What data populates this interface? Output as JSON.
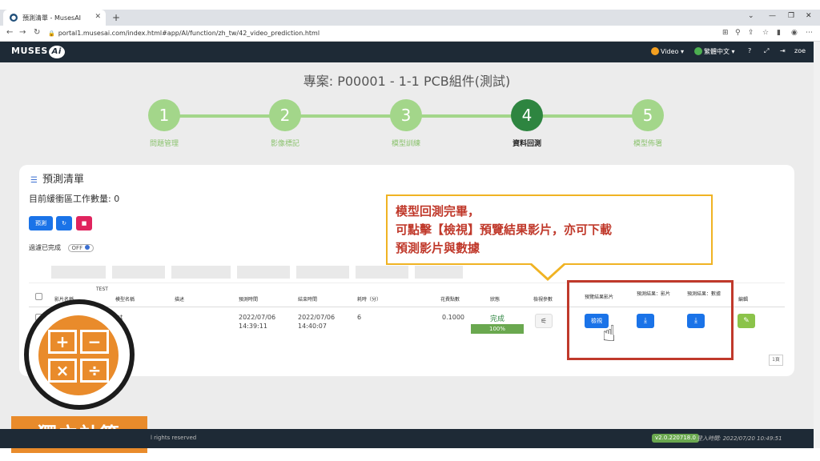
{
  "browser": {
    "tab_title": "預測清單 - MusesAI",
    "new_tab": "+",
    "url": "portal1.musesai.com/index.html#app/AI/function/zh_tw/42_video_prediction.html"
  },
  "header": {
    "logo_text": "MUSES",
    "logo_ai": "Ai",
    "video_label": "Video",
    "lang_label": "繁體中文",
    "user": "zoe"
  },
  "project_title": "專案: P00001 - 1-1 PCB組件(測試)",
  "steps": [
    {
      "num": "1",
      "label": "問題管理"
    },
    {
      "num": "2",
      "label": "影像標記"
    },
    {
      "num": "3",
      "label": "模型訓練"
    },
    {
      "num": "4",
      "label": "資料回測"
    },
    {
      "num": "5",
      "label": "模型佈署"
    }
  ],
  "card": {
    "title": "預測清單",
    "queue_text": "目前緩衝區工作數量: 0",
    "predict_button": "預測",
    "filter_label": "過濾已完成",
    "toggle_label": "OFF"
  },
  "table": {
    "extra_header": "TEST",
    "headers": [
      "影片名稱",
      "模型名稱",
      "描述",
      "預測時間",
      "結束時間",
      "耗時（分）",
      "花費點數",
      "狀態",
      "檢視參數",
      "預覽結果影片",
      "預測結果：影片",
      "預測結果：數據",
      "編輯"
    ],
    "row": {
      "model": "st",
      "predict_time": "2022/07/06\n14:39:11",
      "end_time": "2022/07/06\n14:40:07",
      "duration": "6",
      "points": "0.1000",
      "status": "完成",
      "progress_label": "100%",
      "progress_value": 100,
      "view_button": "檢視"
    },
    "page_size": "1頁"
  },
  "callout": {
    "line1": "模型回測完畢，",
    "line2": "可點擊【檢視】預覽結果影片，亦可下載",
    "line3": "預測影片與數據"
  },
  "overlay": {
    "badge_label": "獨立計算"
  },
  "footer": {
    "copyright": "l rights reserved",
    "version": "v2.0.220718.0",
    "login_time": "登入時間: 2022/07/20 10:49:51"
  },
  "colors": {
    "header_bg": "#1e2a36",
    "step_done": "#a3d68a",
    "step_active": "#2e8540",
    "accent_blue": "#1a73e8",
    "callout_border": "#f0b323",
    "callout_text": "#c0392b",
    "badge_orange": "#e98b2b"
  }
}
